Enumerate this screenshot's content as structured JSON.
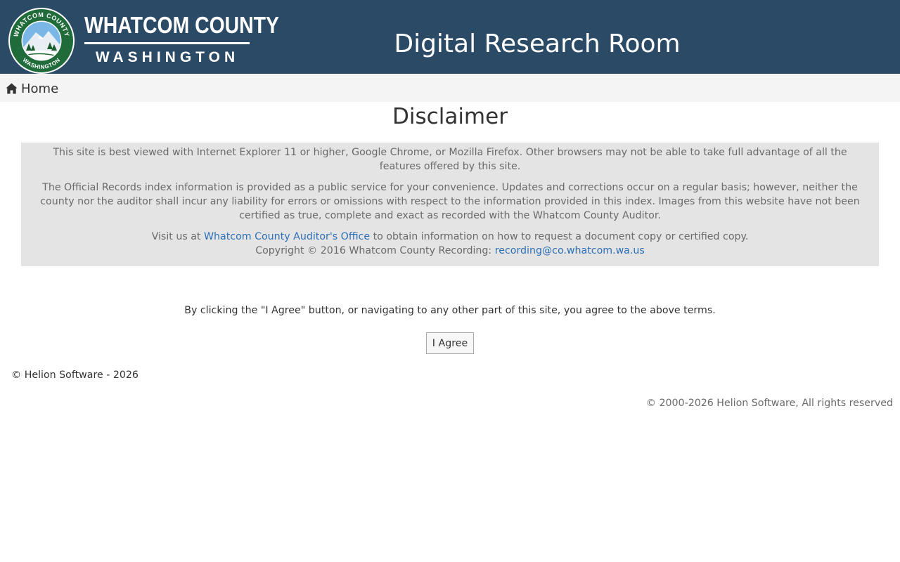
{
  "header": {
    "brand_top": "WHATCOM COUNTY",
    "brand_bottom": "WASHINGTON",
    "site_title": "Digital Research Room",
    "seal": {
      "ring_top_text": "WHATCOM COUNTY",
      "ring_bottom_text": "WASHINGTON"
    }
  },
  "nav": {
    "home_label": "Home"
  },
  "main": {
    "title": "Disclaimer",
    "paragraph1": "This site is best viewed with Internet Explorer 11 or higher, Google Chrome, or Mozilla Firefox. Other browsers may not be able to take full advantage of all the features offered by this site.",
    "paragraph2": "The Official Records index information is provided as a public service for your convenience. Updates and corrections occur on a regular basis; however, neither the county nor the auditor shall incur any liability for errors or omissions with respect to the information provided in this index. Images from this website have not been certified as true, complete and exact as recorded with the Whatcom County Auditor.",
    "visit_prefix": "Visit us at ",
    "visit_link": "Whatcom County Auditor's Office",
    "visit_suffix": " to obtain information on how to request a document copy or certified copy.",
    "copyright_prefix": "Copyright © 2016 Whatcom County Recording: ",
    "copyright_email": "recording@co.whatcom.wa.us",
    "agree_text": "By clicking the \"I Agree\" button, or navigating to any other part of this site, you agree to the above terms.",
    "agree_button": "I Agree"
  },
  "footer": {
    "left": "© Helion Software - 2026",
    "right": "© 2000-2026 Helion Software, All rights reserved"
  },
  "colors": {
    "header_bg": "#2b4a66",
    "nav_bg": "#f4f4f4",
    "disclaimer_bg": "#e4e4e4",
    "link": "#2d6fb5",
    "seal_green": "#1f6b3a"
  },
  "icons": {
    "home": "home-icon",
    "seal": "county-seal-logo"
  }
}
